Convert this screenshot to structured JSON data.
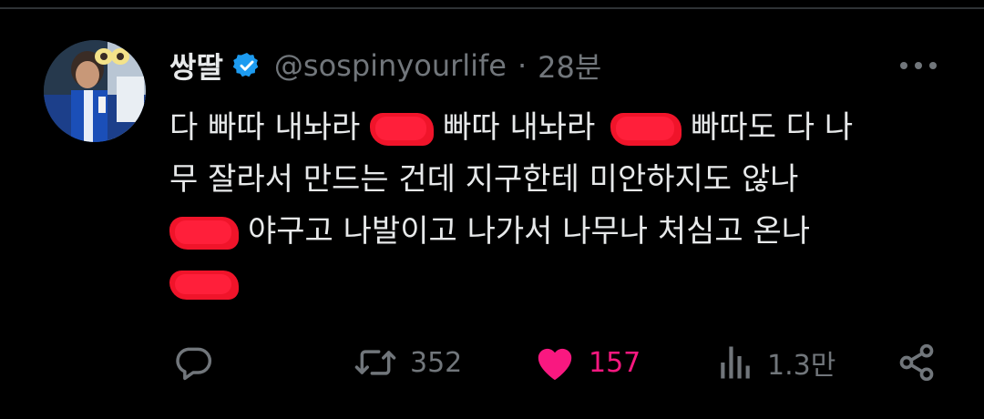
{
  "tweet": {
    "display_name": "쌍딸",
    "verified": true,
    "handle": "@sospinyourlife",
    "separator": "·",
    "time": "28분",
    "text_segments": {
      "line1_a": "다 빠따 내놔라",
      "line1_b": "빠따 내놔라",
      "line1_c": "빠따도 다 나",
      "line2": "무 잘라서 만드는 건데 지구한테 미안하지도 않나",
      "line3": "야구고 나발이고 나가서 나무나 처심고 온나"
    }
  },
  "actions": {
    "reply_count": "",
    "retweet_count": "352",
    "like_count": "157",
    "views_count": "1.3만"
  },
  "colors": {
    "background": "#000000",
    "text": "#e7e9ea",
    "muted": "#71767b",
    "verified_badge": "#1d9bf0",
    "like": "#f91880",
    "redaction": "#f0142a"
  },
  "icons": {
    "verified": "verified-badge-icon",
    "more": "more-dots-icon",
    "reply": "reply-icon",
    "retweet": "retweet-icon",
    "like": "heart-icon",
    "views": "views-icon",
    "share": "share-icon"
  }
}
